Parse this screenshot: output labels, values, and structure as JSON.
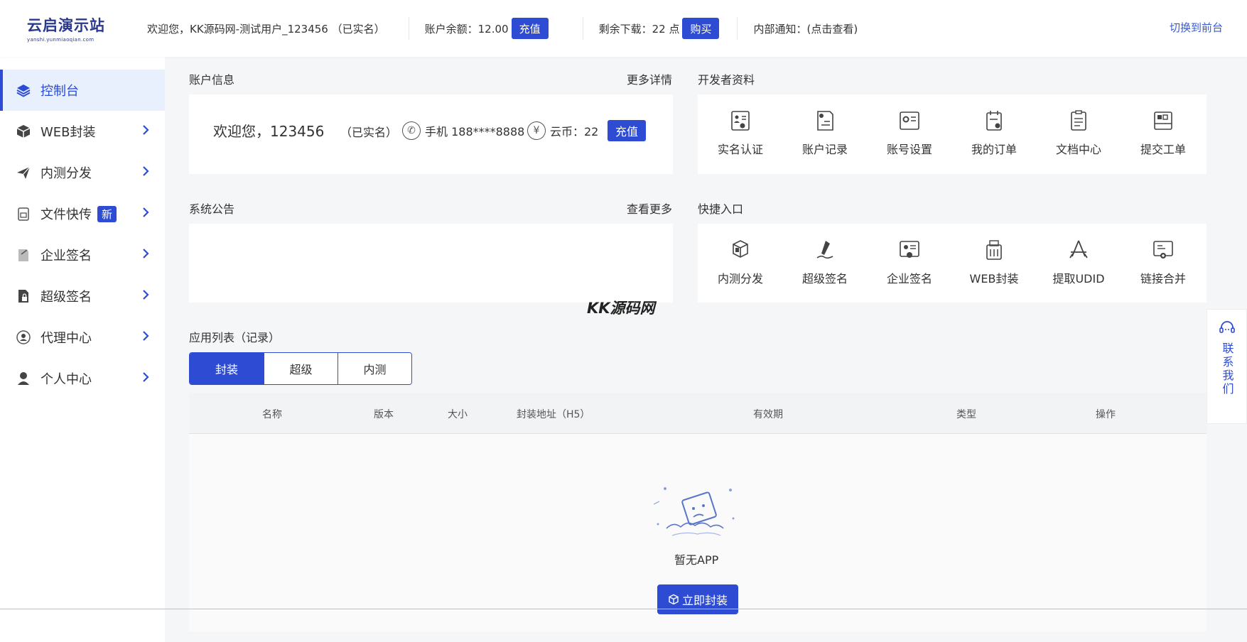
{
  "header": {
    "logo_main": "云启演示站",
    "logo_sub": "yanshi.yunmiaoqian.com",
    "welcome": "欢迎您，KK源码网-测试用户_123456 （已实名）",
    "balance_label": "账户余额：12.00",
    "recharge_label": "充值",
    "downloads_label": "剩余下载：22 点",
    "buy_label": "购买",
    "notice_label": "内部通知：(点击查看)",
    "switch_label": "切换到前台"
  },
  "sidebar": {
    "items": [
      {
        "label": "控制台",
        "icon": "layers-icon"
      },
      {
        "label": "WEB封装",
        "icon": "box-icon"
      },
      {
        "label": "内测分发",
        "icon": "paper-plane-icon"
      },
      {
        "label": "文件快传",
        "icon": "file-icon",
        "badge": "新"
      },
      {
        "label": "企业签名",
        "icon": "clipboard-icon"
      },
      {
        "label": "超级签名",
        "icon": "file-lock-icon"
      },
      {
        "label": "代理中心",
        "icon": "agent-icon"
      },
      {
        "label": "个人中心",
        "icon": "user-icon"
      }
    ]
  },
  "account": {
    "title": "账户信息",
    "more": "更多详情",
    "welcome": "欢迎您，123456",
    "verified": "（已实名）",
    "phone": "手机 188****8888",
    "coin": "云币：22",
    "recharge": "充值"
  },
  "developer": {
    "title": "开发者资料",
    "items": [
      "实名认证",
      "账户记录",
      "账号设置",
      "我的订单",
      "文档中心",
      "提交工单"
    ]
  },
  "announcement": {
    "title": "系统公告",
    "more": "查看更多"
  },
  "quick": {
    "title": "快捷入口",
    "items": [
      "内测分发",
      "超级签名",
      "企业签名",
      "WEB封装",
      "提取UDID",
      "链接合并"
    ]
  },
  "watermark": "KK源码网",
  "apps": {
    "title": "应用列表（记录）",
    "tabs": [
      "封装",
      "超级",
      "内测"
    ],
    "columns": [
      "名称",
      "版本",
      "大小",
      "封装地址（H5）",
      "有效期",
      "类型",
      "操作"
    ],
    "empty_text": "暂无APP",
    "empty_button": "立即封装"
  },
  "contact": {
    "label": "联系我们"
  },
  "colors": {
    "accent": "#2d4cd3",
    "active_bg": "#e8effd"
  }
}
